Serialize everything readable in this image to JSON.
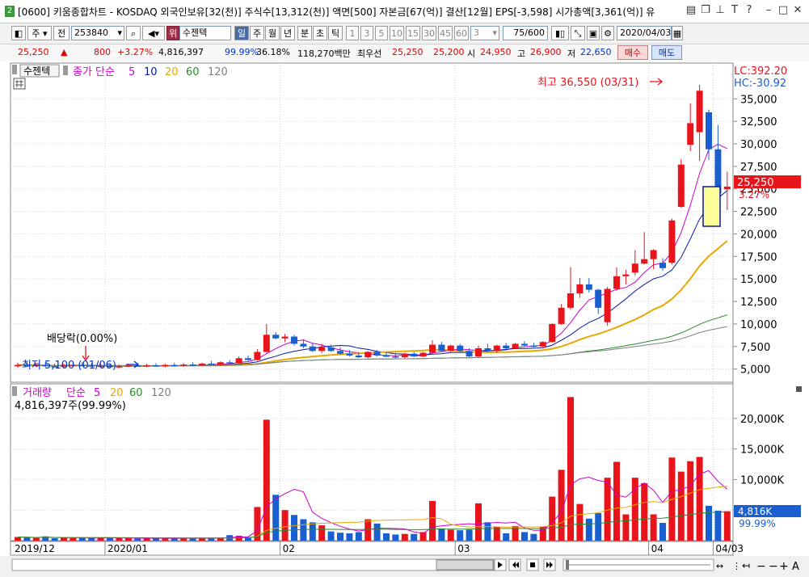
{
  "window": {
    "title": "[0600] 키움종합차트 - KOSDAQ 외국인보유[32(천)] 주식수[13,312(천)] 액면[500] 자본금[67(억)] 결산[12월] EPS[-3,598] 시가총액[3,361(억)] 유",
    "badge": "2"
  },
  "toolbar": {
    "period_label": "주",
    "adj_label": "전",
    "code": "253840",
    "stock_badge": "위",
    "stock_name": "수젠텍",
    "tabs": [
      "일",
      "주",
      "월",
      "년",
      "분",
      "초",
      "틱"
    ],
    "minutes": [
      "1",
      "3",
      "5",
      "10",
      "15",
      "30",
      "45",
      "60"
    ],
    "minute_select": "3",
    "count": "75/600",
    "date": "2020/04/03"
  },
  "quote": {
    "price": "25,250",
    "arrow": "▲",
    "change": "800",
    "change_pct": "+3.27%",
    "volume": "4,816,397",
    "vol_ratio": "99.99%",
    "turnover": "36.18%",
    "amount": "118,270백만",
    "pref_label": "최우선",
    "ask": "25,250",
    "bid": "25,200",
    "open_label": "시",
    "open": "24,950",
    "high_label": "고",
    "high": "26,900",
    "low_label": "저",
    "low": "22,650",
    "buy_label": "매수",
    "sell_label": "매도"
  },
  "chart_labels": {
    "stock_tag": "수젠텍",
    "price_legend": "종가 단순",
    "vol_tag": "거래량",
    "vol_legend": "단순",
    "ma": [
      "5",
      "10",
      "20",
      "60",
      "120"
    ],
    "vol_info": "4,816,397주(99.99%)",
    "max_note": "최고 36,550 (03/31)",
    "min_note": "최저 5,100 (01/06)",
    "dividend_note": "배당락(0.00%)",
    "lc": "LC:392.20",
    "hc": "HC:-30.92",
    "last_price": "25,250",
    "last_pct": "3.27%",
    "last_vol": "4,816K",
    "last_vol_pct": "99.99%"
  },
  "colors": {
    "up": "#e8141c",
    "down": "#1a5fd0",
    "ma5": "#cc00cc",
    "ma10": "#0a1aa0",
    "ma20": "#e8a800",
    "ma60": "#2a8a2a",
    "ma120": "#808080"
  },
  "chart_data": {
    "type": "candlestick",
    "price_axis": {
      "min": 3800,
      "max": 37000,
      "ticks": [
        5000,
        7500,
        10000,
        12500,
        15000,
        17500,
        20000,
        22500,
        25000,
        27500,
        30000,
        32500,
        35000
      ]
    },
    "volume_axis": {
      "min": 0,
      "max": 25000000,
      "ticks": [
        5000000,
        10000000,
        15000000,
        20000000
      ]
    },
    "price_tick_labels": [
      "5,000",
      "7,500",
      "10,000",
      "12,500",
      "15,000",
      "17,500",
      "20,000",
      "22,500",
      "25,000",
      "27,500",
      "30,000",
      "32,500",
      "35,000"
    ],
    "volume_tick_labels": [
      "5,000K",
      "10,000K",
      "15,000K",
      "20,000K"
    ],
    "x_labels": [
      {
        "label": "2019/12",
        "index": 0
      },
      {
        "label": "2020/01",
        "index": 10
      },
      {
        "label": "02",
        "index": 29
      },
      {
        "label": "03",
        "index": 48
      },
      {
        "label": "04",
        "index": 69
      },
      {
        "label": "04/03",
        "index": 76
      }
    ],
    "candles": [
      {
        "o": 5300,
        "h": 5700,
        "l": 5150,
        "c": 5450,
        "v": 600000
      },
      {
        "o": 5450,
        "h": 5800,
        "l": 5300,
        "c": 5400,
        "v": 500000
      },
      {
        "o": 5400,
        "h": 5700,
        "l": 5250,
        "c": 5450,
        "v": 450000
      },
      {
        "o": 5450,
        "h": 5750,
        "l": 5250,
        "c": 5300,
        "v": 700000
      },
      {
        "o": 5300,
        "h": 5600,
        "l": 5200,
        "c": 5250,
        "v": 400000
      },
      {
        "o": 5250,
        "h": 5600,
        "l": 5150,
        "c": 5400,
        "v": 450000
      },
      {
        "o": 5400,
        "h": 5700,
        "l": 5250,
        "c": 5450,
        "v": 400000
      },
      {
        "o": 5450,
        "h": 5750,
        "l": 5300,
        "c": 5400,
        "v": 500000
      },
      {
        "o": 5400,
        "h": 5650,
        "l": 5250,
        "c": 5300,
        "v": 450000
      },
      {
        "o": 5300,
        "h": 5600,
        "l": 5150,
        "c": 5350,
        "v": 400000
      },
      {
        "o": 5350,
        "h": 5600,
        "l": 5150,
        "c": 5200,
        "v": 500000
      },
      {
        "o": 5200,
        "h": 5500,
        "l": 5100,
        "c": 5300,
        "v": 400000
      },
      {
        "o": 5300,
        "h": 5600,
        "l": 5200,
        "c": 5400,
        "v": 400000
      },
      {
        "o": 5400,
        "h": 5650,
        "l": 5250,
        "c": 5300,
        "v": 350000
      },
      {
        "o": 5300,
        "h": 5600,
        "l": 5200,
        "c": 5400,
        "v": 350000
      },
      {
        "o": 5400,
        "h": 5650,
        "l": 5250,
        "c": 5300,
        "v": 400000
      },
      {
        "o": 5300,
        "h": 5600,
        "l": 5200,
        "c": 5450,
        "v": 400000
      },
      {
        "o": 5450,
        "h": 5700,
        "l": 5300,
        "c": 5400,
        "v": 350000
      },
      {
        "o": 5400,
        "h": 5650,
        "l": 5250,
        "c": 5500,
        "v": 400000
      },
      {
        "o": 5500,
        "h": 5750,
        "l": 5350,
        "c": 5400,
        "v": 350000
      },
      {
        "o": 5400,
        "h": 5700,
        "l": 5300,
        "c": 5600,
        "v": 400000
      },
      {
        "o": 5600,
        "h": 5900,
        "l": 5450,
        "c": 5500,
        "v": 400000
      },
      {
        "o": 5500,
        "h": 5850,
        "l": 5400,
        "c": 5750,
        "v": 450000
      },
      {
        "o": 5750,
        "h": 6000,
        "l": 5600,
        "c": 5650,
        "v": 900000
      },
      {
        "o": 5650,
        "h": 6400,
        "l": 5550,
        "c": 6200,
        "v": 800000
      },
      {
        "o": 6200,
        "h": 6500,
        "l": 5900,
        "c": 6000,
        "v": 600000
      },
      {
        "o": 6000,
        "h": 7200,
        "l": 5900,
        "c": 6900,
        "v": 5500000
      },
      {
        "o": 6900,
        "h": 10000,
        "l": 6800,
        "c": 8800,
        "v": 19800000
      },
      {
        "o": 8800,
        "h": 9100,
        "l": 8300,
        "c": 8400,
        "v": 7500000
      },
      {
        "o": 8400,
        "h": 8900,
        "l": 8000,
        "c": 8600,
        "v": 5000000
      },
      {
        "o": 8600,
        "h": 8800,
        "l": 7600,
        "c": 7800,
        "v": 4200000
      },
      {
        "o": 7800,
        "h": 8300,
        "l": 7300,
        "c": 7500,
        "v": 3500000
      },
      {
        "o": 7500,
        "h": 7900,
        "l": 6900,
        "c": 7000,
        "v": 3000000
      },
      {
        "o": 7000,
        "h": 7800,
        "l": 6800,
        "c": 7400,
        "v": 2500000
      },
      {
        "o": 7400,
        "h": 7700,
        "l": 6900,
        "c": 7000,
        "v": 1500000
      },
      {
        "o": 7000,
        "h": 7400,
        "l": 6600,
        "c": 6700,
        "v": 1300000
      },
      {
        "o": 6700,
        "h": 7100,
        "l": 6400,
        "c": 6500,
        "v": 1200000
      },
      {
        "o": 6500,
        "h": 6900,
        "l": 6200,
        "c": 6300,
        "v": 1400000
      },
      {
        "o": 6300,
        "h": 7000,
        "l": 6200,
        "c": 6900,
        "v": 3500000
      },
      {
        "o": 6900,
        "h": 7100,
        "l": 6400,
        "c": 6500,
        "v": 2800000
      },
      {
        "o": 6500,
        "h": 6900,
        "l": 6300,
        "c": 6400,
        "v": 1200000
      },
      {
        "o": 6400,
        "h": 6800,
        "l": 6200,
        "c": 6300,
        "v": 1000000
      },
      {
        "o": 6300,
        "h": 6800,
        "l": 6200,
        "c": 6700,
        "v": 1100000
      },
      {
        "o": 6700,
        "h": 6900,
        "l": 6300,
        "c": 6400,
        "v": 1100000
      },
      {
        "o": 6400,
        "h": 6900,
        "l": 6300,
        "c": 6800,
        "v": 1400000
      },
      {
        "o": 6800,
        "h": 8200,
        "l": 6700,
        "c": 7700,
        "v": 6500000
      },
      {
        "o": 7700,
        "h": 8000,
        "l": 6900,
        "c": 7000,
        "v": 2000000
      },
      {
        "o": 7000,
        "h": 7700,
        "l": 6800,
        "c": 7600,
        "v": 1800000
      },
      {
        "o": 7600,
        "h": 7800,
        "l": 6900,
        "c": 7000,
        "v": 1700000
      },
      {
        "o": 7000,
        "h": 7300,
        "l": 6300,
        "c": 6400,
        "v": 1800000
      },
      {
        "o": 6400,
        "h": 7600,
        "l": 6300,
        "c": 7300,
        "v": 6100000
      },
      {
        "o": 7300,
        "h": 7800,
        "l": 6900,
        "c": 7000,
        "v": 3000000
      },
      {
        "o": 7000,
        "h": 7700,
        "l": 6800,
        "c": 7600,
        "v": 2300000
      },
      {
        "o": 7600,
        "h": 7900,
        "l": 7200,
        "c": 7300,
        "v": 1200000
      },
      {
        "o": 7300,
        "h": 7900,
        "l": 7200,
        "c": 7800,
        "v": 2400000
      },
      {
        "o": 7800,
        "h": 8100,
        "l": 7500,
        "c": 7600,
        "v": 1400000
      },
      {
        "o": 7600,
        "h": 7900,
        "l": 7400,
        "c": 7500,
        "v": 1100000
      },
      {
        "o": 7500,
        "h": 8100,
        "l": 7300,
        "c": 8000,
        "v": 2300000
      },
      {
        "o": 8000,
        "h": 10100,
        "l": 7900,
        "c": 10000,
        "v": 7200000
      },
      {
        "o": 10000,
        "h": 12200,
        "l": 9900,
        "c": 11800,
        "v": 11600000
      },
      {
        "o": 11800,
        "h": 16300,
        "l": 11600,
        "c": 13400,
        "v": 23500000
      },
      {
        "o": 13400,
        "h": 15100,
        "l": 12900,
        "c": 14400,
        "v": 6000000
      },
      {
        "o": 14400,
        "h": 15100,
        "l": 13500,
        "c": 13800,
        "v": 3600000
      },
      {
        "o": 13800,
        "h": 13900,
        "l": 11100,
        "c": 11800,
        "v": 4500000
      },
      {
        "o": 10200,
        "h": 14100,
        "l": 9800,
        "c": 13900,
        "v": 10300000
      },
      {
        "o": 13900,
        "h": 16300,
        "l": 13700,
        "c": 15300,
        "v": 12900000
      },
      {
        "o": 15300,
        "h": 16000,
        "l": 14400,
        "c": 15500,
        "v": 4300000
      },
      {
        "o": 15700,
        "h": 18200,
        "l": 15400,
        "c": 16700,
        "v": 10300000
      },
      {
        "o": 16700,
        "h": 20200,
        "l": 16600,
        "c": 17200,
        "v": 9400000
      },
      {
        "o": 17200,
        "h": 18300,
        "l": 16100,
        "c": 18200,
        "v": 4300000
      },
      {
        "o": 16800,
        "h": 17300,
        "l": 15900,
        "c": 16200,
        "v": 2900000
      },
      {
        "o": 16800,
        "h": 21700,
        "l": 16600,
        "c": 21500,
        "v": 13600000
      },
      {
        "o": 23000,
        "h": 28300,
        "l": 22900,
        "c": 27700,
        "v": 11300000
      },
      {
        "o": 29900,
        "h": 34500,
        "l": 29200,
        "c": 32300,
        "v": 13000000
      },
      {
        "o": 31300,
        "h": 36550,
        "l": 28100,
        "c": 35900,
        "v": 13700000
      },
      {
        "o": 33500,
        "h": 33800,
        "l": 28200,
        "c": 29400,
        "v": 5700000
      },
      {
        "o": 29400,
        "h": 32100,
        "l": 22900,
        "c": 24500,
        "v": 4900000
      },
      {
        "o": 24950,
        "h": 26900,
        "l": 22650,
        "c": 25250,
        "v": 4816397
      }
    ]
  }
}
